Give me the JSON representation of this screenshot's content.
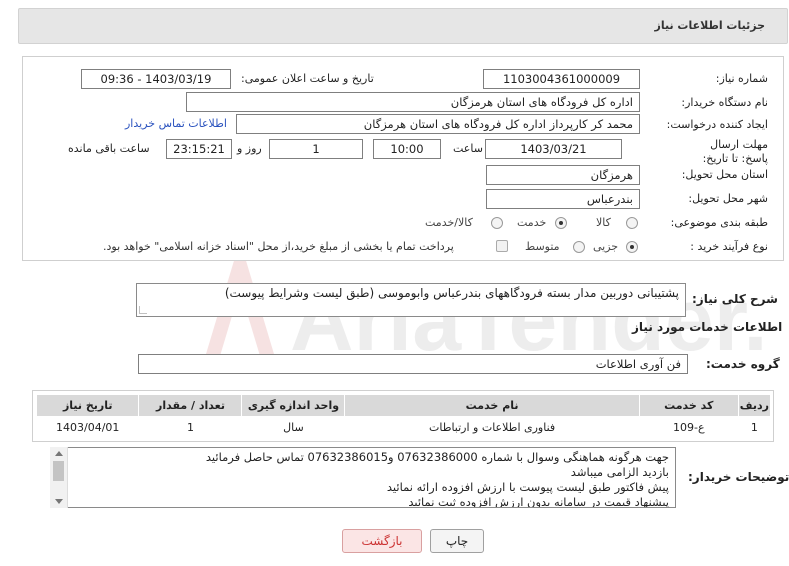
{
  "header": {
    "title": "جزئیات اطلاعات نیاز"
  },
  "labels": {
    "need_number": "شماره نیاز:",
    "announce_datetime": "تاریخ و ساعت اعلان عمومی:",
    "buyer_org": "نام دستگاه خریدار:",
    "requester": "ایجاد کننده درخواست:",
    "deadline": "مهلت ارسال پاسخ: تا تاریخ:",
    "hour": "ساعت",
    "day_and": "روز و",
    "remaining": "ساعت باقی مانده",
    "province": "استان محل تحویل:",
    "city": "شهر محل تحویل:",
    "category": "طبقه بندی موضوعی:",
    "process": "نوع فرآیند خرید :"
  },
  "values": {
    "need_number": "1103004361000009",
    "announce_datetime": "1403/03/19 - 09:36",
    "buyer_org": "اداره کل فرودگاه های استان هرمزگان",
    "requester": "محمد کر کارپرداز اداره کل فرودگاه های استان هرمزگان",
    "contact_link": "اطلاعات تماس خریدار",
    "deadline_date": "1403/03/21",
    "deadline_time": "10:00",
    "days": "1",
    "remaining_time": "23:15:21",
    "province": "هرمزگان",
    "city": "بندرعباس"
  },
  "category_options": [
    {
      "label": "کالا",
      "checked": false
    },
    {
      "label": "خدمت",
      "checked": true
    },
    {
      "label": "کالا/خدمت",
      "checked": false
    }
  ],
  "process_options": [
    {
      "label": "جزیی",
      "checked": true
    },
    {
      "label": "متوسط",
      "checked": false
    }
  ],
  "payment_note": "پرداخت تمام یا بخشی از مبلغ خرید،از محل \"اسناد خزانه اسلامی\" خواهد بود.",
  "need_summary": {
    "label": "شرح کلی نیاز:",
    "text": "پشتیبانی دوربین مدار بسته فرودگاههای بندرعباس وابوموسی (طبق لیست وشرایط پیوست)"
  },
  "services_section": {
    "title": "اطلاعات خدمات مورد نیاز",
    "group_label": "گروه خدمت:",
    "group_value": "فن آوری اطلاعات"
  },
  "table": {
    "headers": [
      "ردیف",
      "کد خدمت",
      "نام خدمت",
      "واحد اندازه گیری",
      "تعداد / مقدار",
      "تاریخ نیاز"
    ],
    "rows": [
      [
        "1",
        "ع-109",
        "فناوری اطلاعات و ارتباطات",
        "سال",
        "1",
        "1403/04/01"
      ]
    ]
  },
  "buyer_notes": {
    "label": "توضیحات خریدار:",
    "lines": [
      "جهت هرگونه هماهنگی وسوال با شماره 07632386000 و07632386015 تماس حاصل فرمائید",
      "بازدید الزامی میباشد",
      "پیش فاکتور طبق لیست پیوست با ارزش افزوده ارائه نمائید",
      "پیشنهاد قیمت در سامانه بدون ارزش افزوده ثبت نمائید"
    ]
  },
  "buttons": {
    "print": "چاپ",
    "back": "بازگشت"
  },
  "watermark": "AriaTender.net",
  "colors": {
    "link": "#2a52be",
    "header_bg": "#e6e6e6",
    "back_button": "#cc3333"
  }
}
